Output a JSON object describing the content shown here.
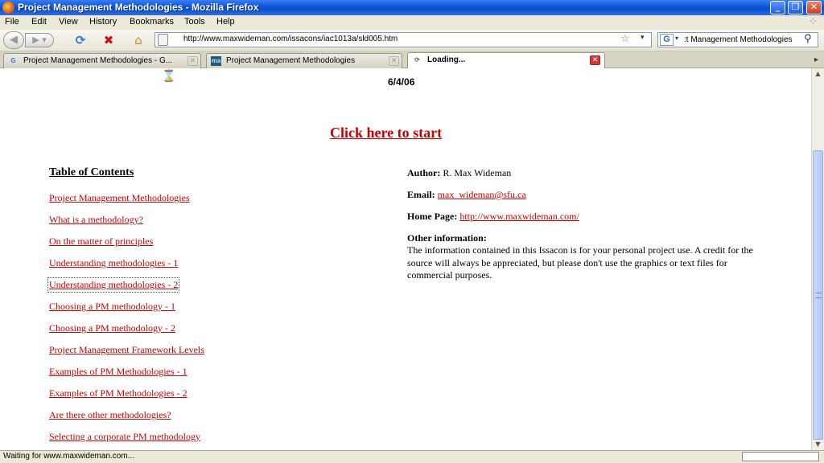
{
  "window": {
    "title": "Project Management Methodologies - Mozilla Firefox",
    "controls": {
      "minimize": "_",
      "maximize": "❐",
      "close": "✕"
    }
  },
  "menu": [
    "File",
    "Edit",
    "View",
    "History",
    "Bookmarks",
    "Tools",
    "Help"
  ],
  "nav": {
    "back_icon": "◀",
    "forward_icon": "▶ ▾",
    "reload_icon": "⟳",
    "stop_icon": "✖",
    "home_icon": "⌂",
    "url": "http://www.maxwideman.com/issacons/iac1013a/sld005.htm",
    "bookmark_star": "☆",
    "url_dropdown": "▾",
    "search_engine": "G",
    "search_dropdown": "▾",
    "search_text": ":t Management Methodologies",
    "search_icon": "⚲"
  },
  "tabs": [
    {
      "label": "Project Management Methodologies - G...",
      "favicon": "G",
      "favicon_color": "#3a6fd8"
    },
    {
      "label": "Project Management Methodologies",
      "favicon": "ma",
      "favicon_color": "#1f5a7a"
    },
    {
      "label": "Loading...",
      "favicon": "⟳",
      "favicon_color": "#666666"
    }
  ],
  "tab_close": "✕",
  "tab_scroll": "▸",
  "content": {
    "date": "6/4/06",
    "start_link": "Click here to start",
    "toc_title": "Table of Contents",
    "toc": [
      "Project Management Methodologies",
      "What is a methodology?",
      "On the matter of principles",
      "Understanding methodologies - 1",
      "Understanding methodologies - 2",
      "Choosing a PM methodology - 1",
      "Choosing a PM methodology - 2",
      "Project Management Framework Levels",
      "Examples of PM Methodologies - 1",
      "Examples of PM Methodologies - 2",
      "Are there other methodologies?",
      "Selecting a corporate PM methodology"
    ],
    "author_label": "Author:",
    "author_value": "R. Max Wideman",
    "email_label": "Email:",
    "email_value": "max_wideman@sfu.ca",
    "homepage_label": "Home Page:",
    "homepage_value": "http://www.maxwideman.com/",
    "other_label": "Other information:",
    "other_text": "The information contained in this Issacon is for your personal project use. A credit for the source will always be appreciated, but please don't use the graphics or text files for commercial purposes."
  },
  "scrollbar": {
    "up": "▲",
    "down": "▼"
  },
  "status": {
    "text": "Waiting for www.maxwideman.com..."
  },
  "colors": {
    "link": "#cc0000",
    "titlebar": "#0a55d8",
    "chrome": "#ece9d8"
  }
}
